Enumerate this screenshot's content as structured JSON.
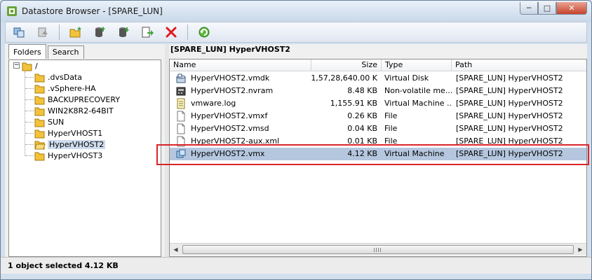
{
  "window": {
    "title": "Datastore Browser - [SPARE_LUN]",
    "controls": {
      "minimize": "─",
      "maximize": "□",
      "close": "✕"
    }
  },
  "toolbar": {
    "buttons": [
      {
        "name": "datastore-browser-button",
        "icon": "datastore-icon"
      },
      {
        "name": "upload-button-disabled",
        "icon": "upload-icon"
      },
      {
        "name": "new-folder-button",
        "icon": "new-folder-icon"
      },
      {
        "name": "upload-file-button",
        "icon": "disk-upload-icon"
      },
      {
        "name": "download-file-button",
        "icon": "disk-download-icon"
      },
      {
        "name": "register-vm-button",
        "icon": "register-icon"
      },
      {
        "name": "delete-button",
        "icon": "delete-icon"
      },
      {
        "name": "refresh-button",
        "icon": "refresh-icon"
      }
    ]
  },
  "tabs": {
    "folders": "Folders",
    "search": "Search"
  },
  "tree": {
    "root": "/",
    "items": [
      ".dvsData",
      ".vSphere-HA",
      "BACKUPRECOVERY",
      "WIN2K8R2-64BIT",
      "SUN",
      "HyperVHOST1",
      "HyperVHOST2",
      "HyperVHOST3"
    ],
    "selected_index": 6
  },
  "list": {
    "header_path": "[SPARE_LUN] HyperVHOST2",
    "columns": {
      "name": "Name",
      "size": "Size",
      "type": "Type",
      "path": "Path"
    },
    "rows": [
      {
        "name": "HyperVHOST2.vmdk",
        "size": "1,57,28,640.00 K",
        "type": "Virtual Disk",
        "path": "[SPARE_LUN] HyperVHOST2",
        "icon": "virtual-disk-icon"
      },
      {
        "name": "HyperVHOST2.nvram",
        "size": "8.48 KB",
        "type": "Non-volatile me...",
        "path": "[SPARE_LUN] HyperVHOST2",
        "icon": "nvram-icon"
      },
      {
        "name": "vmware.log",
        "size": "1,155.91 KB",
        "type": "Virtual Machine ...",
        "path": "[SPARE_LUN] HyperVHOST2",
        "icon": "log-file-icon"
      },
      {
        "name": "HyperVHOST2.vmxf",
        "size": "0.26 KB",
        "type": "File",
        "path": "[SPARE_LUN] HyperVHOST2",
        "icon": "file-icon"
      },
      {
        "name": "HyperVHOST2.vmsd",
        "size": "0.04 KB",
        "type": "File",
        "path": "[SPARE_LUN] HyperVHOST2",
        "icon": "file-icon"
      },
      {
        "name": "HyperVHOST2-aux.xml",
        "size": "0.01 KB",
        "type": "File",
        "path": "[SPARE_LUN] HyperVHOST2",
        "icon": "file-icon"
      },
      {
        "name": "HyperVHOST2.vmx",
        "size": "4.12 KB",
        "type": "Virtual Machine",
        "path": "[SPARE_LUN] HyperVHOST2",
        "icon": "virtual-machine-icon"
      }
    ],
    "selected_index": 6
  },
  "status": {
    "text": "1 object selected 4.12 KB"
  },
  "colors": {
    "selection": "#b5c7de",
    "highlight": "#d9252a",
    "folder": "#f2c33a"
  }
}
